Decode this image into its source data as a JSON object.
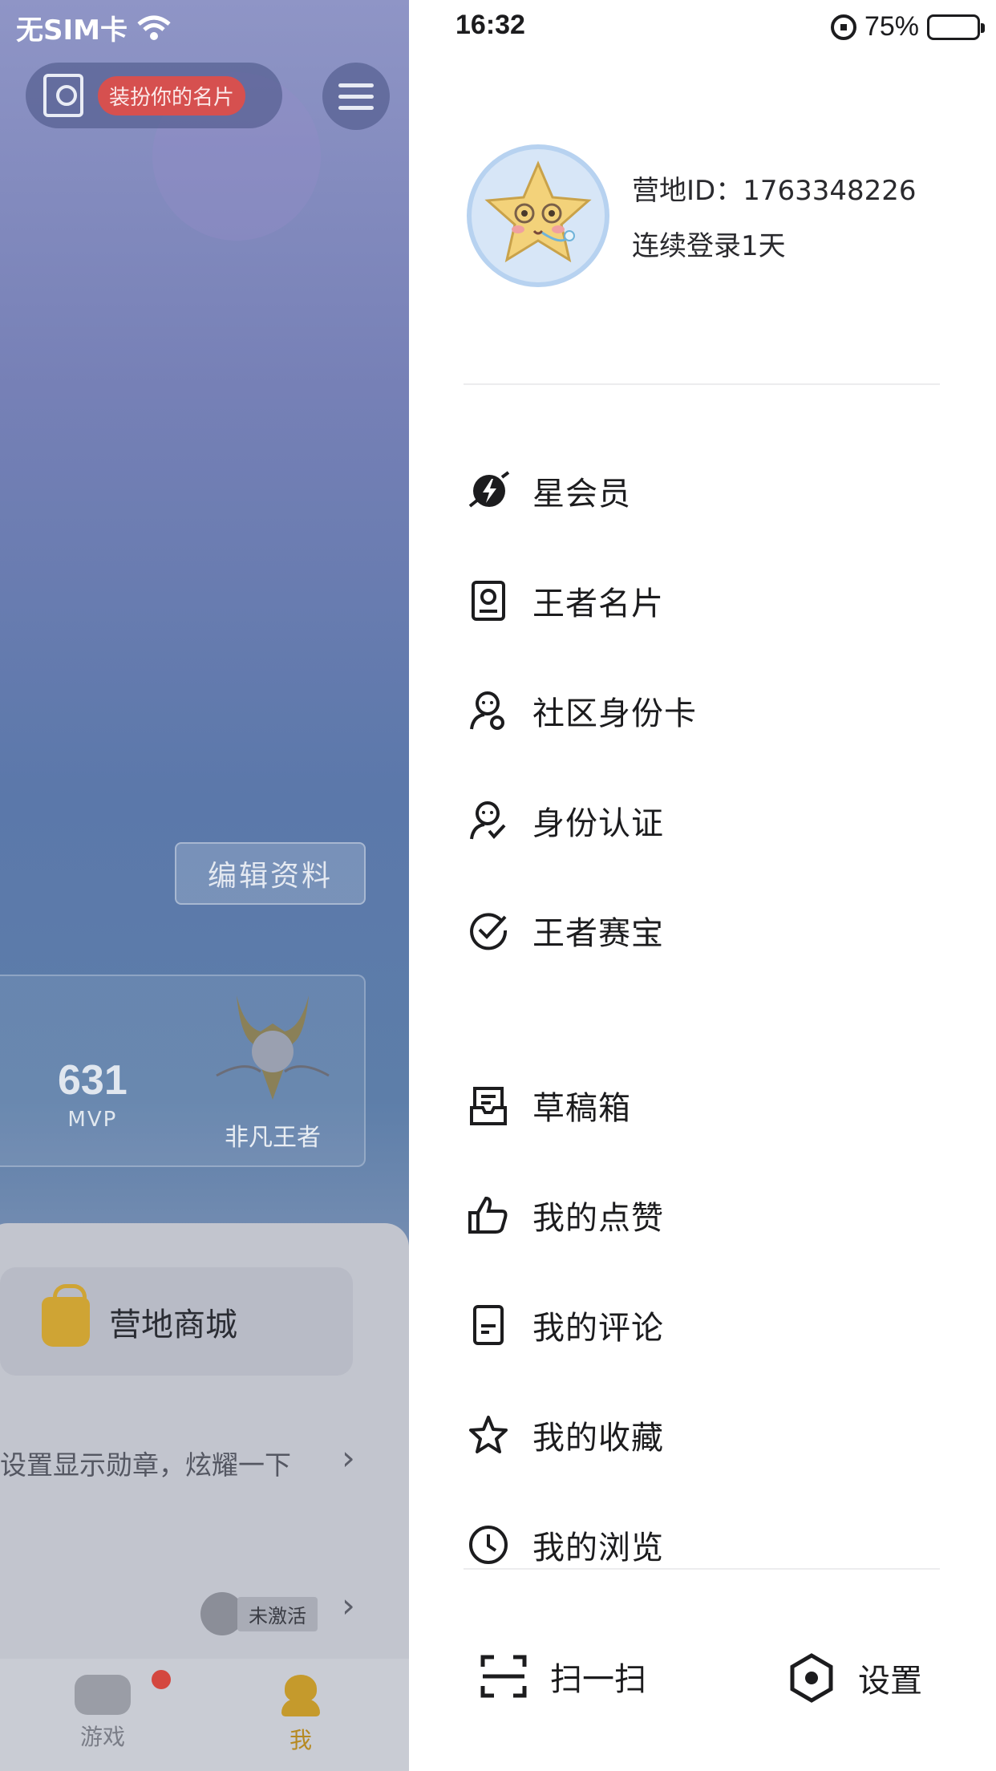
{
  "left_pane": {
    "carrier": "无SIM卡",
    "card_pill_label": "装扮你的名片",
    "edit_button": "编辑资料",
    "mvp_value": "631",
    "mvp_label": "MVP",
    "rank_label": "非凡王者",
    "shop_label": "营地商城",
    "medal_text": "设置显示勋章，炫耀一下",
    "inactive_label": "未激活",
    "tabs": [
      {
        "label": "游戏",
        "icon": "gamepad-icon"
      },
      {
        "label": "我",
        "icon": "user-icon"
      }
    ],
    "accent_color": "#c59a2c"
  },
  "status_bar": {
    "time": "16:32",
    "battery": "75%",
    "battery_level": 0.75
  },
  "profile": {
    "camp_id": "营地ID：1763348226",
    "login_streak": "连续登录1天"
  },
  "menu": {
    "group1": [
      {
        "label": "星会员",
        "icon": "star-member-icon"
      },
      {
        "label": "王者名片",
        "icon": "name-card-icon"
      },
      {
        "label": "社区身份卡",
        "icon": "community-id-icon"
      },
      {
        "label": "身份认证",
        "icon": "verify-identity-icon"
      },
      {
        "label": "王者赛宝",
        "icon": "check-circle-icon"
      }
    ],
    "group2": [
      {
        "label": "草稿箱",
        "icon": "drafts-icon"
      },
      {
        "label": "我的点赞",
        "icon": "thumbs-up-icon"
      },
      {
        "label": "我的评论",
        "icon": "comment-doc-icon"
      },
      {
        "label": "我的收藏",
        "icon": "star-icon"
      },
      {
        "label": "我的浏览",
        "icon": "clock-icon"
      }
    ]
  },
  "bottom": {
    "scan": "扫一扫",
    "settings": "设置"
  }
}
